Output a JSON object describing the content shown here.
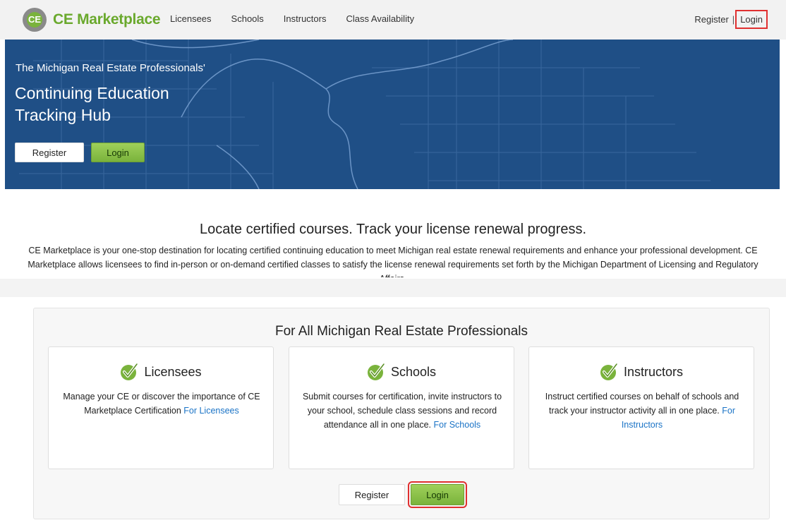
{
  "nav": {
    "logo_letters": "CE",
    "brand": "CE Marketplace",
    "links": [
      "Licensees",
      "Schools",
      "Instructors",
      "Class Availability"
    ],
    "register": "Register",
    "separator": "|",
    "login": "Login"
  },
  "hero": {
    "eyebrow": "The Michigan Real Estate Professionals'",
    "title_line1": "Continuing Education",
    "title_line2": "Tracking Hub",
    "register_button": "Register",
    "login_button": "Login"
  },
  "intro": {
    "headline": "Locate certified courses. Track your license renewal progress.",
    "body": "CE Marketplace is your one-stop destination for locating certified continuing education to meet Michigan real estate renewal requirements and enhance your professional development. CE Marketplace allows licensees to find in-person or on-demand certified classes to satisfy the license renewal requirements set forth by the Michigan Department of Licensing and Regulatory Affairs."
  },
  "panel": {
    "title": "For All Michigan Real Estate Professionals",
    "cards": [
      {
        "title": "Licensees",
        "text": "Manage your CE or discover the importance of CE Marketplace Certification ",
        "link": "For Licensees"
      },
      {
        "title": "Schools",
        "text": "Submit courses for certification, invite instructors to your school, schedule class sessions and record attendance all in one place. ",
        "link": "For Schools"
      },
      {
        "title": "Instructors",
        "text": "Instruct certified courses on behalf of schools and track your instructor activity all in one place. ",
        "link": "For Instructors"
      }
    ],
    "register_button": "Register",
    "login_button": "Login"
  },
  "colors": {
    "brand_green": "#6aa92d",
    "hero_blue": "#1f4f86",
    "link_blue": "#1a73c6",
    "highlight_red": "#e03030"
  },
  "icons": {
    "logo": "ce-logo-icon",
    "card_check": "green-checkmark-icon"
  }
}
